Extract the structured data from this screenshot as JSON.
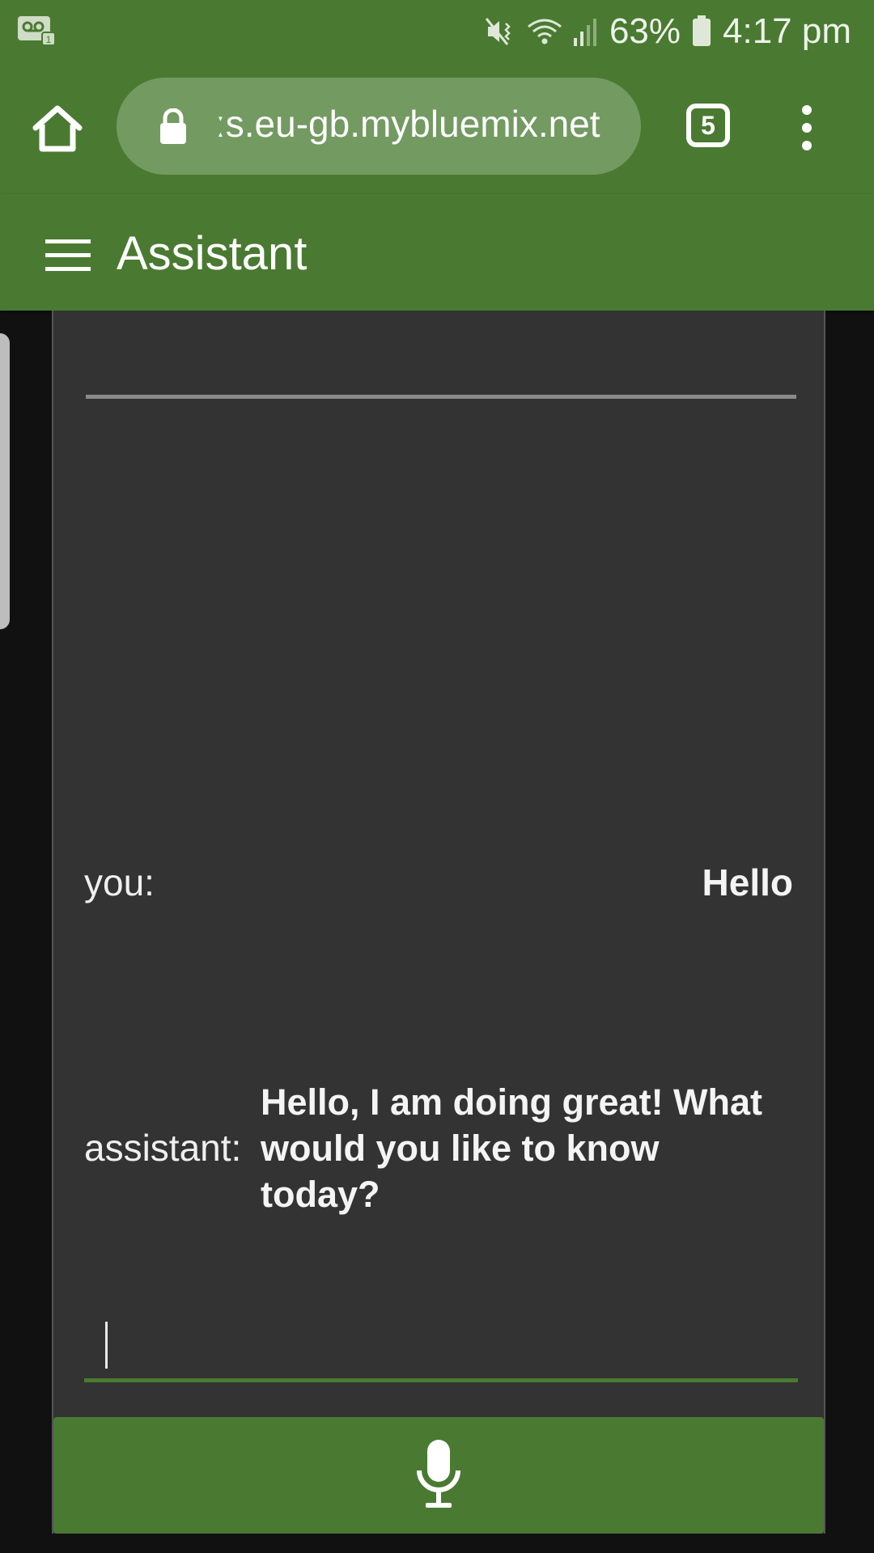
{
  "status_bar": {
    "battery": "63%",
    "time": "4:17 pm",
    "icons": [
      "voicemail-icon",
      "mute-vibrate-icon",
      "wifi-icon",
      "signal-icon",
      "battery-icon"
    ]
  },
  "browser": {
    "url": "ːs.eu-gb.mybluemix.net",
    "tab_count": "5"
  },
  "app": {
    "title": "Assistant",
    "accent_color": "#4a7a31",
    "panel_color": "#333333"
  },
  "conversation": {
    "messages": [
      {
        "speaker": "you:",
        "text": "Hello"
      },
      {
        "speaker": "assistant:",
        "text": "Hello, I am doing great! What would you like to know today?"
      }
    ]
  },
  "input": {
    "value": ""
  }
}
